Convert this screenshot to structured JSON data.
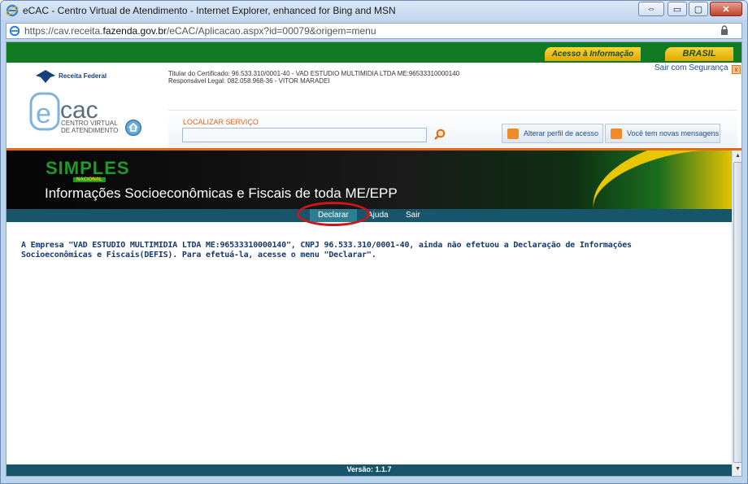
{
  "window": {
    "title": "eCAC - Centro Virtual de Atendimento - Internet Explorer, enhanced for Bing and MSN",
    "url_prefix": "https://cav.receita.",
    "url_domain": "fazenda.gov.br",
    "url_suffix": "/eCAC/Aplicacao.aspx?id=00079&origem=menu",
    "buttons": {
      "restore": "⇔",
      "minimize": "▭",
      "maximize": "▢",
      "close": "✕"
    }
  },
  "govbar": {
    "acesso": "Acesso à Informação",
    "brasil": "BRASIL"
  },
  "header": {
    "receita_label": "Receita Federal",
    "ecac_sub_line1": "CENTRO VIRTUAL",
    "ecac_sub_line2": "DE ATENDIMENTO",
    "titular": "Titular do Certificado: 96.533.310/0001-40 - VAD ESTUDIO MULTIMIDIA LTDA ME:96533310000140",
    "responsavel": "Responsável Legal: 082.058.968-36 - VITOR MARADEI",
    "sair_seguranca": "Sair com Segurança",
    "sair_x": "x",
    "localizar_label": "LOCALIZAR SERVIÇO",
    "localizar_value": "",
    "alterar_perfil": "Alterar perfil de acesso",
    "mensagens": "Você tem novas mensagens"
  },
  "banner": {
    "logo": "SIMPLES",
    "logo_sub": "NACIONAL",
    "title": "Informações Socioeconômicas e Fiscais de toda ME/EPP"
  },
  "menu": {
    "declarar": "Declarar",
    "ajuda": "Ajuda",
    "sair": "Sair"
  },
  "message": {
    "line1": "A Empresa \"VAD ESTUDIO MULTIMIDIA LTDA ME:96533310000140\", CNPJ 96.533.310/0001-40, ainda não efetuou a Declaração de Informações",
    "line2": "Socioeconômicas e Fiscais(DEFIS). Para efetuá-la, acesse o menu \"Declarar\"."
  },
  "footer": {
    "versao": "Versão: 1.1.7"
  },
  "colors": {
    "gov_green": "#0f7a22",
    "menu_teal": "#17566a",
    "highlight_red": "#d0141b",
    "orange_accent": "#e26b1a"
  }
}
